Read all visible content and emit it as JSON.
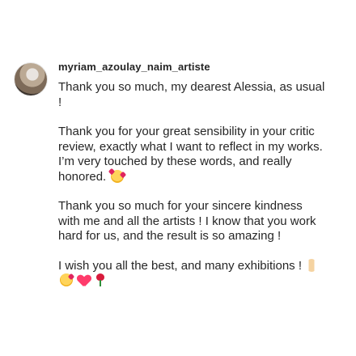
{
  "comment": {
    "username": "myriam_azoulay_naim_artiste",
    "paragraphs": [
      "Thank you so much, my dearest Alessia, as usual !",
      "Thank you for your great sensibility in your critic review, exactly what I want to reflect in my works. I’m very touched by these words, and really honored.",
      "Thank you so much for your sincere kindness with me and all the artists ! I know that you work hard for us, and the result is so amazing !",
      "I wish you all the best, and many exhibitions !"
    ],
    "emojis": {
      "paragraph_2": [
        "smiling-face-with-hearts"
      ],
      "paragraph_4": [
        "crossed-fingers",
        "face-blowing-a-kiss",
        "red-heart",
        "rose"
      ]
    }
  }
}
